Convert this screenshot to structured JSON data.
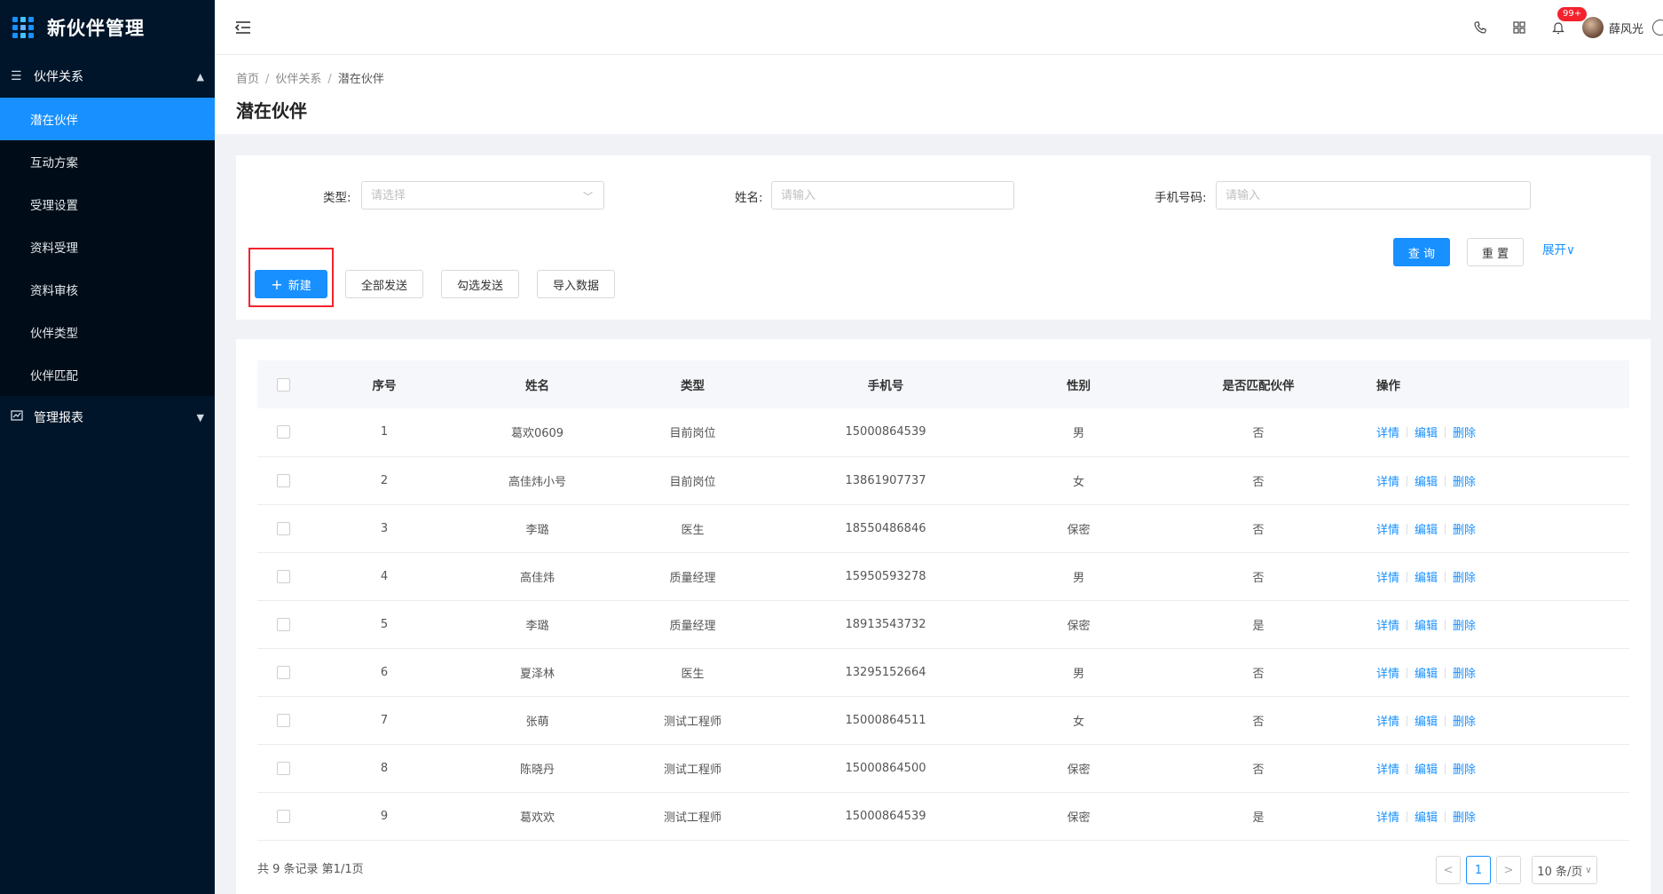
{
  "app": {
    "title": "新伙伴管理"
  },
  "sidebar": {
    "groups": [
      {
        "label": "伙伴关系",
        "expanded": true,
        "items": [
          {
            "label": "潜在伙伴",
            "active": true
          },
          {
            "label": "互动方案"
          },
          {
            "label": "受理设置"
          },
          {
            "label": "资料受理"
          },
          {
            "label": "资料审核"
          },
          {
            "label": "伙伴类型"
          },
          {
            "label": "伙伴匹配"
          }
        ]
      },
      {
        "label": "管理报表",
        "expanded": false,
        "items": []
      }
    ]
  },
  "topbar": {
    "icons": [
      "phone-icon",
      "grid-icon",
      "bell-icon",
      "globe-icon"
    ],
    "badge": "99+",
    "username": "薛风光"
  },
  "breadcrumb": [
    "首页",
    "伙伴关系",
    "潜在伙伴"
  ],
  "page_title": "潜在伙伴",
  "search": {
    "type_label": "类型:",
    "type_placeholder": "请选择",
    "name_label": "姓名:",
    "name_placeholder": "请输入",
    "phone_label": "手机号码:",
    "phone_placeholder": "请输入",
    "query": "查 询",
    "reset": "重 置",
    "expand": "展开"
  },
  "actions": {
    "new": "新建",
    "send_all": "全部发送",
    "send_selected": "勾选发送",
    "import": "导入数据"
  },
  "table": {
    "columns": [
      "序号",
      "姓名",
      "类型",
      "手机号",
      "性别",
      "是否匹配伙伴",
      "操作"
    ],
    "rows": [
      [
        "1",
        "葛欢0609",
        "目前岗位",
        "15000864539",
        "男",
        "否"
      ],
      [
        "2",
        "高佳炜小号",
        "目前岗位",
        "13861907737",
        "女",
        "否"
      ],
      [
        "3",
        "李璐",
        "医生",
        "18550486846",
        "保密",
        "否"
      ],
      [
        "4",
        "高佳炜",
        "质量经理",
        "15950593278",
        "男",
        "否"
      ],
      [
        "5",
        "李璐",
        "质量经理",
        "18913543732",
        "保密",
        "是"
      ],
      [
        "6",
        "夏泽林",
        "医生",
        "13295152664",
        "男",
        "否"
      ],
      [
        "7",
        "张萌",
        "测试工程师",
        "15000864511",
        "女",
        "否"
      ],
      [
        "8",
        "陈晓丹",
        "测试工程师",
        "15000864500",
        "保密",
        "否"
      ],
      [
        "9",
        "葛欢欢",
        "测试工程师",
        "15000864539",
        "保密",
        "是"
      ]
    ],
    "ops": [
      "详情",
      "编辑",
      "删除"
    ]
  },
  "pagination": {
    "summary": "共 9 条记录 第1/1页",
    "prev": "<",
    "current": "1",
    "next": ">",
    "page_size": "10 条/页"
  },
  "colors": {
    "primary": "#1890ff",
    "sidebar": "#001529",
    "highlight": "#f5222d"
  }
}
